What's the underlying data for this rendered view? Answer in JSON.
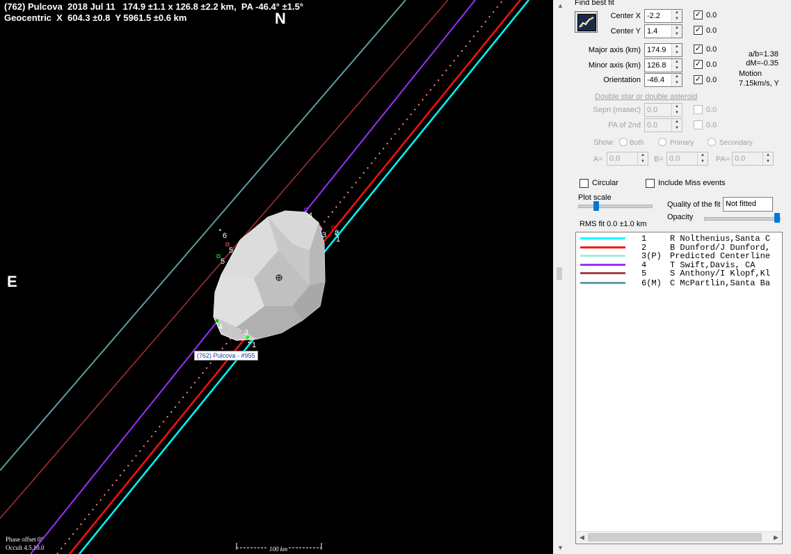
{
  "plot": {
    "title_line1": "(762) Pulcova  2018 Jul 11   174.9 ±1.1 x 126.8 ±2.2 km,  PA -46.4° ±1.5°",
    "title_line2": "Geocentric  X  604.3 ±0.8  Y 5961.5 ±0.6 km",
    "north_label": "N",
    "east_label": "E",
    "asteroid_tag": "(762) Pulcova - #955",
    "phase_offset": "Phase offset 0°",
    "version": "Occult 4.5.10.0",
    "scale_label": "100 km",
    "chord_numbers": [
      "1",
      "2",
      "3",
      "4",
      "5",
      "6"
    ],
    "colors": {
      "chord1": "#00ffff",
      "chord2": "#ff1010",
      "chord3": "#ff9090",
      "chord4": "#9b30ff",
      "chord5": "#b03030",
      "chord6": "#5f9ea0"
    }
  },
  "panel": {
    "find_best_fit": "Find best fit",
    "center_x": {
      "label": "Center X",
      "value": "-2.2",
      "check": "0.0"
    },
    "center_y": {
      "label": "Center Y",
      "value": "1.4",
      "check": "0.0"
    },
    "major_axis": {
      "label": "Major axis (km)",
      "value": "174.9",
      "check": "0.0"
    },
    "minor_axis": {
      "label": "Minor axis (km)",
      "value": "126.8",
      "check": "0.0"
    },
    "orientation": {
      "label": "Orientation",
      "value": "-46.4",
      "check": "0.0"
    },
    "ab_ratio": "a/b=1.38",
    "dm": "dM=-0.35",
    "motion_label": "Motion",
    "motion_value": "7.15km/s, Y",
    "double_star_link": "Double star  or  double asteroid",
    "sepn": {
      "label": "Sepn (masec)",
      "value": "0.0",
      "check": "0.0"
    },
    "pa2nd": {
      "label": "PA of 2nd",
      "value": "0.0",
      "check": "0.0"
    },
    "show_label": "Show:",
    "show_both": "Both",
    "show_primary": "Primary",
    "show_secondary": "Secondary",
    "a_label": "A=",
    "a_value": "0.0",
    "b_label": "B=",
    "b_value": "0.0",
    "pa_label": "PA=",
    "pa_value": "0.0",
    "circular": "Circular",
    "include_miss": "Include Miss events",
    "plot_scale": "Plot scale",
    "quality_label": "Quality of the fit",
    "quality_value": "Not fitted",
    "opacity_label": "Opacity",
    "rms_fit": "RMS fit  0.0 ±1.0 km"
  },
  "legend": [
    {
      "num": "1",
      "name": "R Nolthenius,Santa C",
      "color": "#00ffff"
    },
    {
      "num": "2",
      "name": "B Dunford/J Dunford,",
      "color": "#ff1010"
    },
    {
      "num": "3(P)",
      "name": "Predicted Centerline",
      "color": "#a0f0d8"
    },
    {
      "num": "4",
      "name": "T Swift,Davis, CA",
      "color": "#9b30ff"
    },
    {
      "num": "5",
      "name": "S Anthony/I Klopf,Kl",
      "color": "#a04040"
    },
    {
      "num": "6(M)",
      "name": "C McPartlin,Santa Ba",
      "color": "#5f9ea0"
    }
  ]
}
